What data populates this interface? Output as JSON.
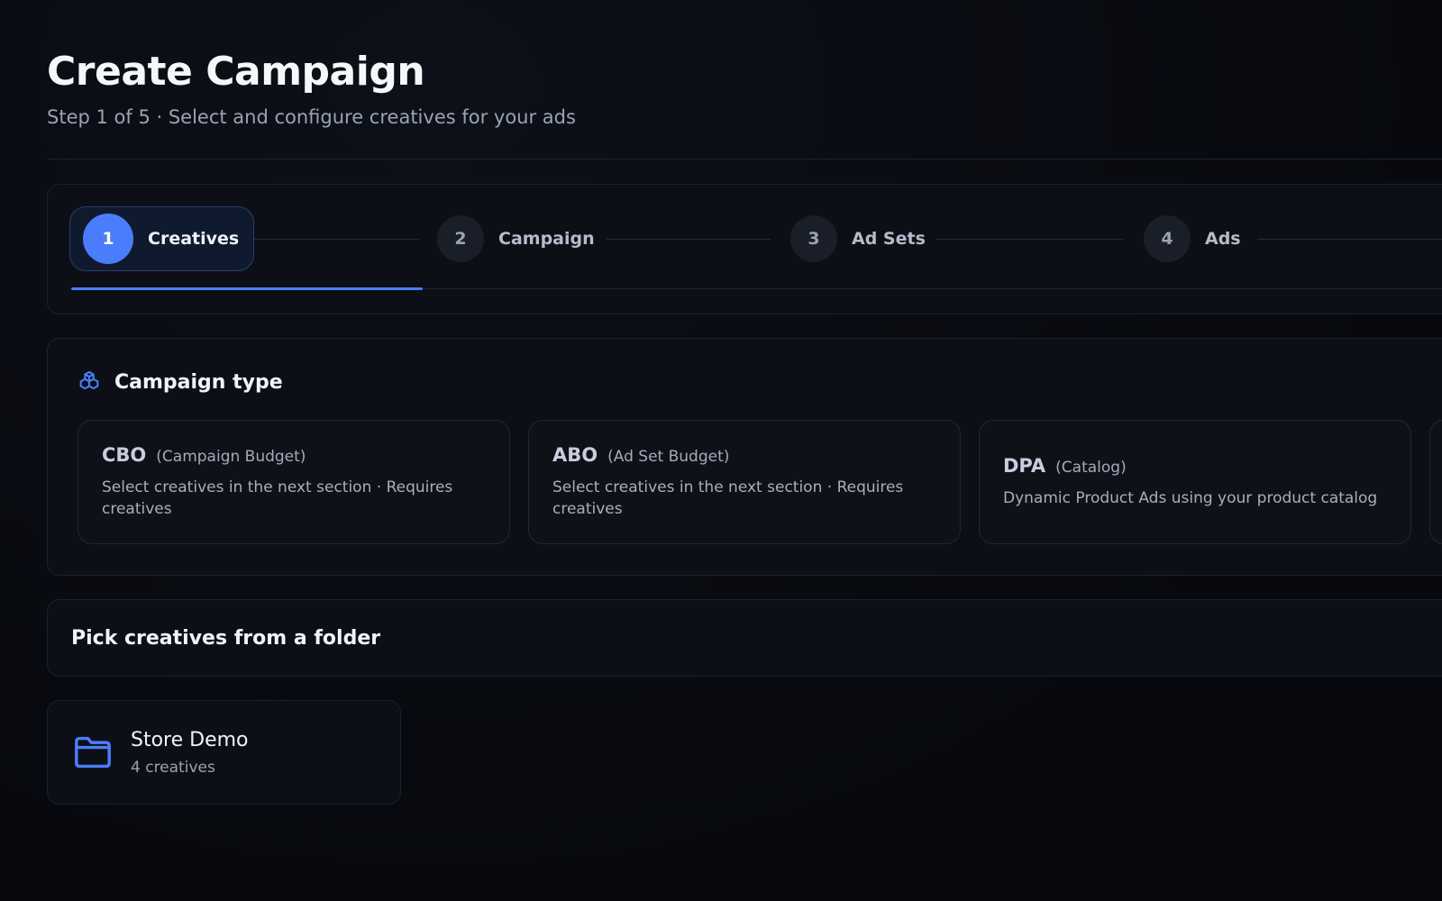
{
  "header": {
    "title": "Create Campaign",
    "subtitle": "Step 1 of 5 · Select and configure creatives for your ads"
  },
  "stepper": {
    "steps": [
      {
        "number": "1",
        "label": "Creatives",
        "active": true
      },
      {
        "number": "2",
        "label": "Campaign",
        "active": false
      },
      {
        "number": "3",
        "label": "Ad Sets",
        "active": false
      },
      {
        "number": "4",
        "label": "Ads",
        "active": false
      }
    ],
    "progress_fraction": 0.25
  },
  "campaign_type": {
    "title": "Campaign type",
    "icon": "cubes-icon",
    "options": [
      {
        "name": "CBO",
        "sub": "(Campaign Budget)",
        "desc": "Select creatives in the next section · Requires creatives"
      },
      {
        "name": "ABO",
        "sub": "(Ad Set Budget)",
        "desc": "Select creatives in the next section · Requires creatives"
      },
      {
        "name": "DPA",
        "sub": "(Catalog)",
        "desc": "Dynamic Product Ads using your product catalog"
      }
    ]
  },
  "pick_creatives": {
    "title": "Pick creatives from a folder"
  },
  "folders": [
    {
      "name": "Store Demo",
      "count": "4 creatives",
      "icon": "folder-icon"
    }
  ],
  "colors": {
    "accent": "#4a7dfc",
    "background": "#080a10",
    "card": "#0c0f16"
  }
}
